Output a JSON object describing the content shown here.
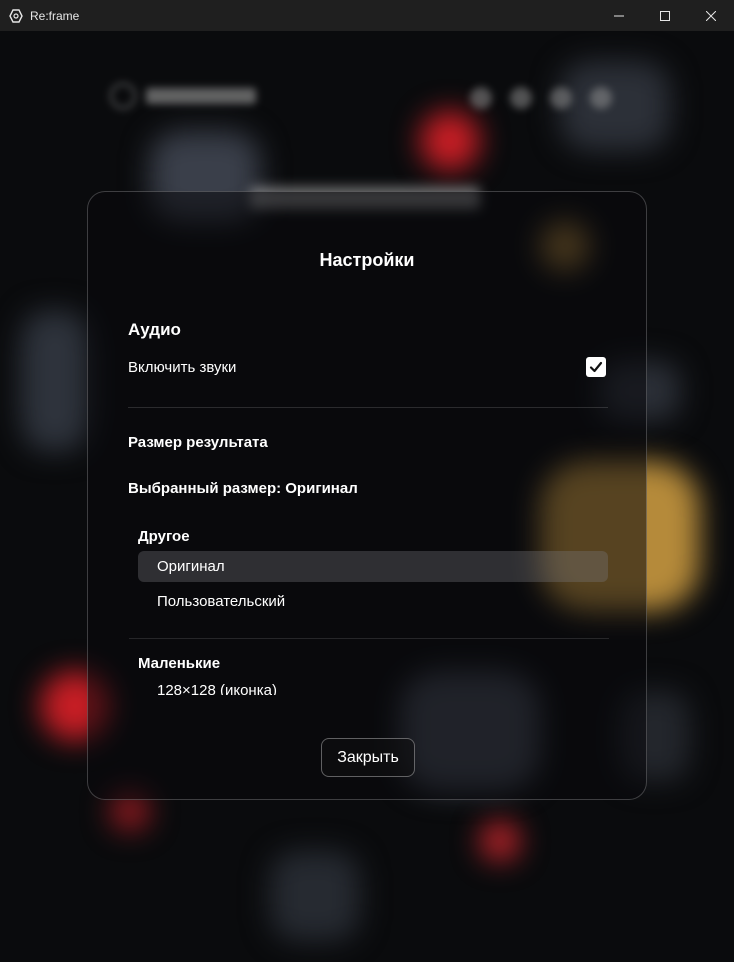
{
  "window": {
    "title": "Re:frame",
    "icon": "app-logo-icon",
    "controls": [
      "minimize-icon",
      "maximize-icon",
      "close-icon"
    ]
  },
  "settings": {
    "title": "Настройки",
    "audio": {
      "heading": "Аудио",
      "enable_sounds_label": "Включить звуки",
      "enable_sounds_checked": true
    },
    "output_size": {
      "heading": "Размер результата",
      "selected_label": "Выбранный размер: Оригинал"
    },
    "size_list": {
      "group_other": "Другое",
      "options_other": [
        {
          "label": "Оригинал",
          "selected": true
        },
        {
          "label": "Пользовательский",
          "selected": false
        }
      ],
      "group_small": "Маленькие",
      "options_small": [
        {
          "label": "128×128 (иконка)",
          "selected": false
        }
      ]
    },
    "close_button": "Закрыть"
  },
  "colors": {
    "titlebar": "#1f1f1f",
    "selected_option": "#4a4a4f",
    "accent_red": "#c81e25",
    "accent_gold": "#b58a3a"
  }
}
